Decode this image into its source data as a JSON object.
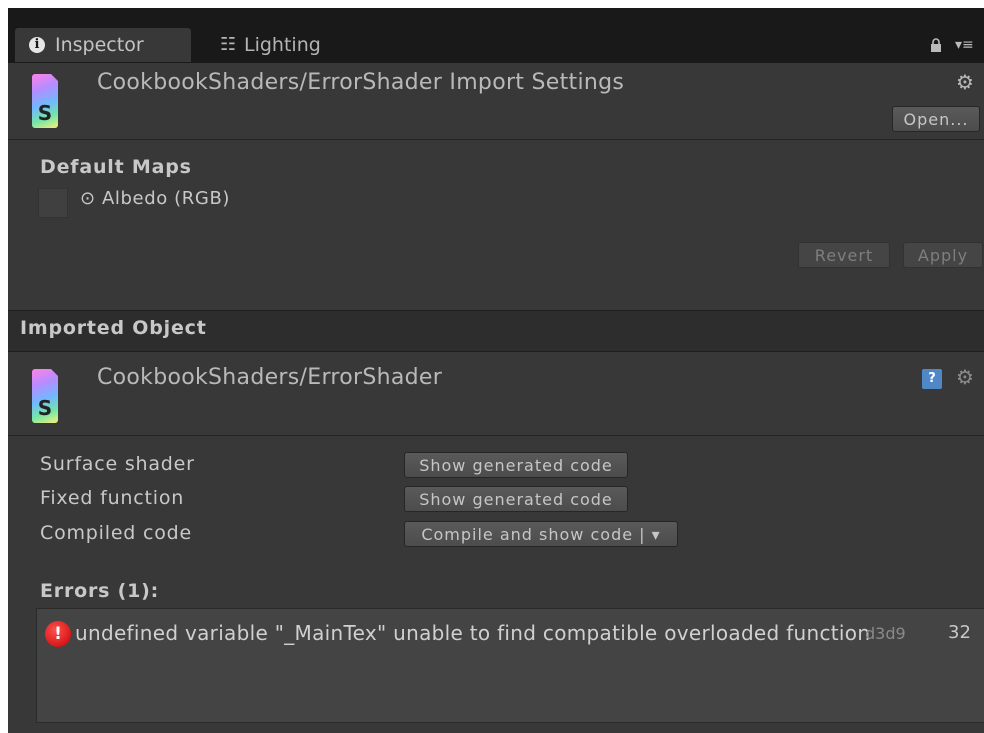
{
  "tabs": [
    {
      "label": "Inspector",
      "icon": "info-icon"
    },
    {
      "label": "Lighting",
      "icon": "lighting-sliders-icon"
    }
  ],
  "header": {
    "title": "CookbookShaders/ErrorShader Import Settings",
    "open_button": "Open...",
    "file_icon_letter": "S"
  },
  "default_maps": {
    "label": "Default Maps",
    "albedo_label": "⊙ Albedo (RGB)"
  },
  "actions": {
    "revert": "Revert",
    "apply": "Apply"
  },
  "imported_object": {
    "label": "Imported Object",
    "title": "CookbookShaders/ErrorShader",
    "file_icon_letter": "S"
  },
  "properties": [
    {
      "label": "Surface shader",
      "button": "Show generated code"
    },
    {
      "label": "Fixed function",
      "button": "Show generated code"
    },
    {
      "label": "Compiled code",
      "button": "Compile and show code | ▾"
    }
  ],
  "errors": {
    "label": "Errors (1):",
    "items": [
      {
        "message": "undefined variable \"_MainTex\" unable to find compatible overloaded function",
        "platform": "d3d9",
        "line": "32"
      }
    ]
  },
  "colors": {
    "panel": "#383838",
    "tabbar": "#191919",
    "error_red": "#d01010",
    "help_blue": "#4f87c7"
  }
}
